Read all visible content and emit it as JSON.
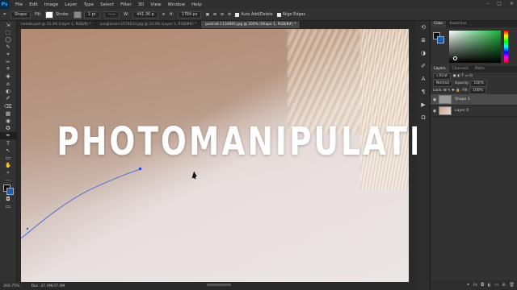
{
  "app": {
    "logo": "Ps"
  },
  "menubar": {
    "items": [
      "File",
      "Edit",
      "Image",
      "Layer",
      "Type",
      "Select",
      "Filter",
      "3D",
      "View",
      "Window",
      "Help"
    ],
    "window_controls": [
      "–",
      "□",
      "✕"
    ]
  },
  "options": {
    "mode": "Shape",
    "fill_label": "Fill:",
    "stroke_label": "Stroke:",
    "stroke_width": "1 pt",
    "w_label": "W:",
    "w_value": "441.36 p",
    "h_label": "H:",
    "h_value": "1784 px",
    "auto_add_delete": "Auto Add/Delete",
    "align_edges": "Align Edges"
  },
  "tabs": [
    {
      "label": "needle.psd @ 33.3% (Layer 1, RGB/8) *",
      "active": false
    },
    {
      "label": "sunglasses-1574433.jpg @ 33.3% (Layer 1, RGB/8#) *",
      "active": false
    },
    {
      "label": "portrait-1134685.jpg @ 200% (Shape 1, RGB/8#) *",
      "active": true
    }
  ],
  "tools": [
    "⇲",
    "⬚",
    "◯",
    "✎",
    "⌖",
    "✂",
    "⌗",
    "✚",
    "⌂",
    "◐",
    "✐",
    "⌫",
    "▦",
    "◉",
    "✪",
    "✒",
    "T",
    "↖",
    "▭",
    "✋",
    "⌕",
    "⋯"
  ],
  "status": {
    "zoom": "200.75%",
    "doc": "Doc: 37.4M/37.4M"
  },
  "overlay_text": "PHOTOMANIPULATION",
  "panels": {
    "color_tabs": [
      "Color",
      "Swatches"
    ],
    "layers_tabs": [
      "Layers",
      "Channels",
      "Paths"
    ],
    "kind_label": "Kind",
    "blend_mode": "Normal",
    "opacity_label": "Opacity:",
    "opacity_value": "100%",
    "lock_label": "Lock:",
    "fill_label": "Fill:",
    "fill_value": "100%",
    "layers": [
      {
        "name": "Shape 1",
        "active": true
      },
      {
        "name": "Layer 0",
        "active": false
      }
    ]
  },
  "colors": {
    "foreground": "#111111",
    "background": "#1c5bb8",
    "path_stroke": "#3a5fd0"
  },
  "chart_data": null
}
